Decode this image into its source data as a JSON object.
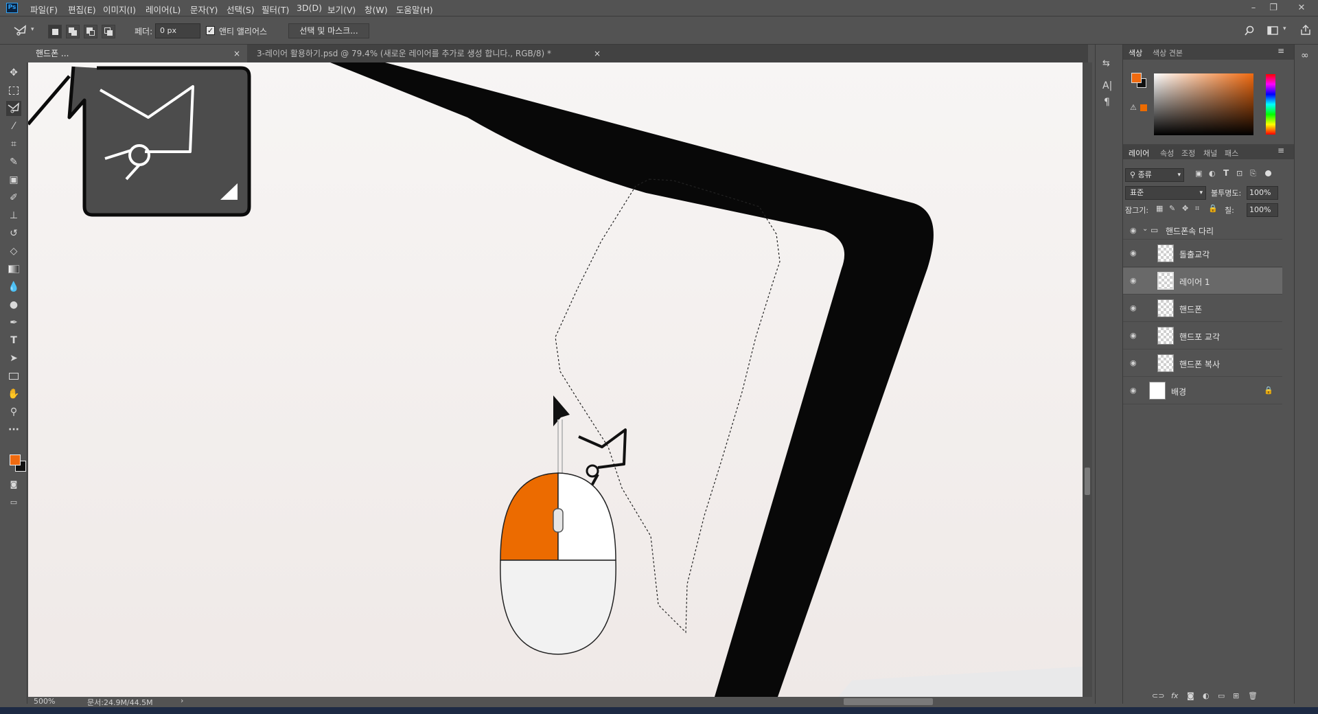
{
  "app": {
    "logo": "Ps"
  },
  "menu": [
    "파일(F)",
    "편집(E)",
    "이미지(I)",
    "레이어(L)",
    "문자(Y)",
    "선택(S)",
    "필터(T)",
    "3D(D)",
    "보기(V)",
    "창(W)",
    "도움말(H)"
  ],
  "window_controls": {
    "minimize": "–",
    "restore": "❐",
    "close": "✕"
  },
  "options": {
    "feather_label": "페더:",
    "feather_value": "0 px",
    "antialias_label": "앤티 앨리어스",
    "antialias_checked": true,
    "select_mask_button": "선택 및 마스크..."
  },
  "tabs": [
    {
      "label": "핸드폰 ...",
      "active": true
    },
    {
      "label": "3-레이어 활용하기.psd @ 79.4% (새로운  레이어를 추가로 생성 합니다., RGB/8) *",
      "active": false
    }
  ],
  "status": {
    "zoom": "500%",
    "doc": "문서:24.9M/44.5M"
  },
  "colors": {
    "foreground": "#f06a10",
    "background": "#111111",
    "accent": "#ec6b00"
  },
  "color_panel": {
    "tabs": [
      "색상",
      "색상 견본"
    ]
  },
  "layers_panel": {
    "tabs": [
      "레이어",
      "속성",
      "조정",
      "채널",
      "패스"
    ],
    "filter_label": "종류",
    "blend_mode": "표준",
    "opacity_label": "불투명도:",
    "opacity_value": "100%",
    "lock_label": "잠그기:",
    "fill_label": "칠:",
    "fill_value": "100%",
    "group_name": "핸드폰속 다리",
    "layers": [
      {
        "name": "돌출교각",
        "selected": false,
        "in_group": true
      },
      {
        "name": "레이어 1",
        "selected": true,
        "in_group": true
      },
      {
        "name": "핸드폰",
        "selected": false,
        "in_group": true
      },
      {
        "name": "핸드포 교각",
        "selected": false,
        "in_group": true
      },
      {
        "name": "핸드폰 복사",
        "selected": false,
        "in_group": true
      },
      {
        "name": "배경",
        "selected": false,
        "in_group": false,
        "locked": true
      }
    ]
  },
  "tools": [
    "move-icon",
    "marquee-icon",
    "polygonal-lasso-icon",
    "magic-wand-icon",
    "crop-icon",
    "eyedropper-icon",
    "healing-icon",
    "brush-icon",
    "stamp-icon",
    "history-brush-icon",
    "eraser-icon",
    "gradient-icon",
    "blur-icon",
    "dodge-icon",
    "pen-icon",
    "type-icon",
    "path-select-icon",
    "rectangle-icon",
    "hand-icon",
    "zoom-icon",
    "more-icon"
  ]
}
